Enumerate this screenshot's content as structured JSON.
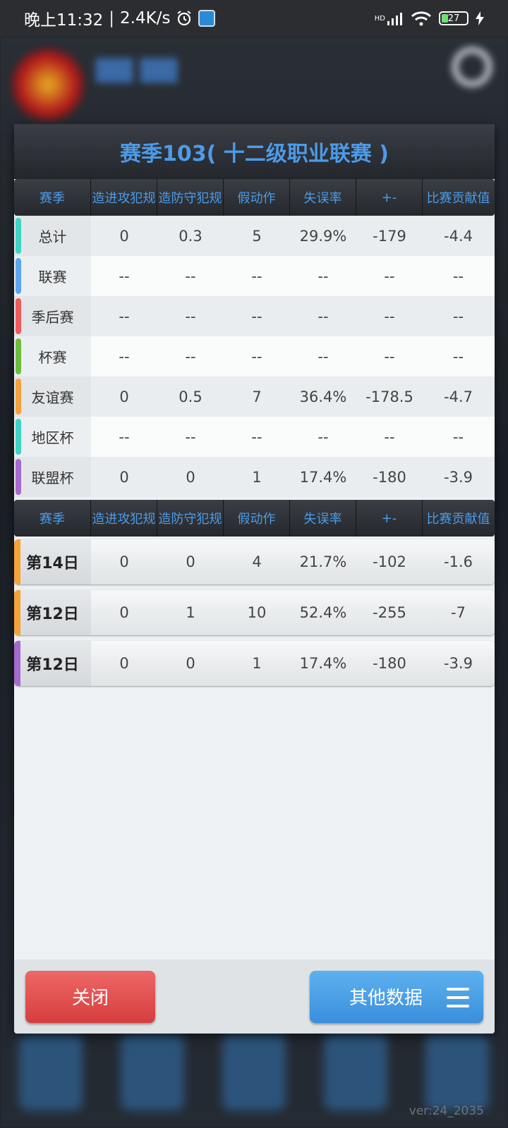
{
  "statusbar": {
    "time": "晚上11:32",
    "speed": "2.4K/s",
    "signal_label": "HD",
    "battery": "27"
  },
  "background": {
    "version": "ver:24_2035"
  },
  "modal": {
    "title": "赛季103( 十二级职业联赛 )",
    "columns": [
      "赛季",
      "造进攻犯规",
      "造防守犯规",
      "假动作",
      "失误率",
      "+-",
      "比赛贡献值"
    ],
    "season_rows": [
      {
        "label": "总计",
        "color": "#3fd3c3",
        "values": [
          "0",
          "0.3",
          "5",
          "29.9%",
          "-179",
          "-4.4"
        ]
      },
      {
        "label": "联赛",
        "color": "#5da6ef",
        "values": [
          "--",
          "--",
          "--",
          "--",
          "--",
          "--"
        ]
      },
      {
        "label": "季后赛",
        "color": "#ef5b5b",
        "values": [
          "--",
          "--",
          "--",
          "--",
          "--",
          "--"
        ]
      },
      {
        "label": "杯赛",
        "color": "#6cbd3c",
        "values": [
          "--",
          "--",
          "--",
          "--",
          "--",
          "--"
        ]
      },
      {
        "label": "友谊赛",
        "color": "#f5a23a",
        "values": [
          "0",
          "0.5",
          "7",
          "36.4%",
          "-178.5",
          "-4.7"
        ]
      },
      {
        "label": "地区杯",
        "color": "#3fd3c3",
        "values": [
          "--",
          "--",
          "--",
          "--",
          "--",
          "--"
        ]
      },
      {
        "label": "联盟杯",
        "color": "#a66ad0",
        "values": [
          "0",
          "0",
          "1",
          "17.4%",
          "-180",
          "-3.9"
        ]
      }
    ],
    "day_rows": [
      {
        "label": "第14日",
        "color": "#f5a23a",
        "values": [
          "0",
          "0",
          "4",
          "21.7%",
          "-102",
          "-1.6"
        ]
      },
      {
        "label": "第12日",
        "color": "#f5a23a",
        "values": [
          "0",
          "1",
          "10",
          "52.4%",
          "-255",
          "-7"
        ]
      },
      {
        "label": "第12日",
        "color": "#a66ad0",
        "values": [
          "0",
          "0",
          "1",
          "17.4%",
          "-180",
          "-3.9"
        ]
      }
    ],
    "buttons": {
      "close": "关闭",
      "other": "其他数据"
    }
  }
}
